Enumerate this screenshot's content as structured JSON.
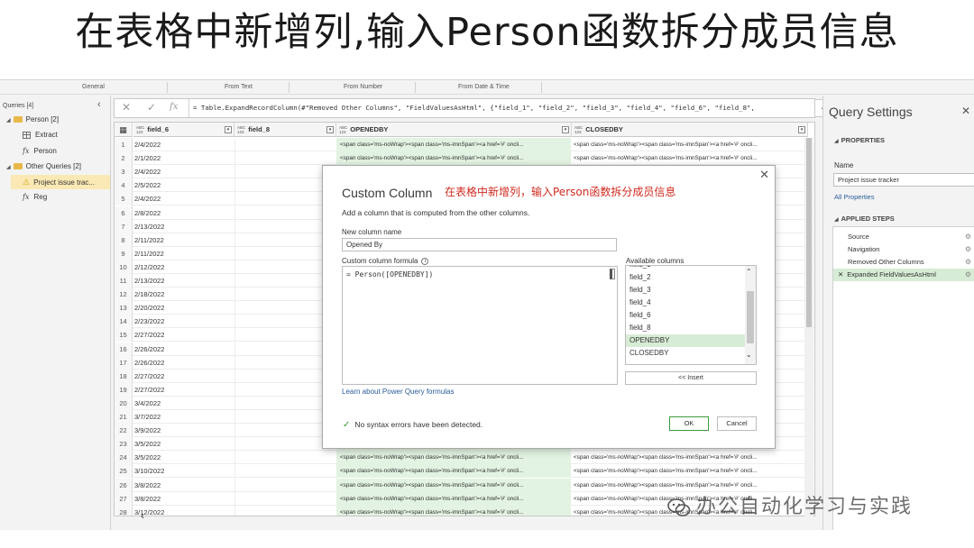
{
  "banner": "在表格中新增列,输入Person函数拆分成员信息",
  "ribbon": {
    "groups": [
      "General",
      "From Text",
      "From Number",
      "From Date & Time"
    ]
  },
  "queries": {
    "header": "Queries [4]",
    "items": [
      {
        "label": "Person [2]",
        "kind": "folder"
      },
      {
        "label": "Extract",
        "kind": "table"
      },
      {
        "label": "Person",
        "kind": "function"
      },
      {
        "label": "Other Queries [2]",
        "kind": "folder"
      },
      {
        "label": "Project issue trac...",
        "kind": "warning"
      },
      {
        "label": "Reg",
        "kind": "function"
      }
    ]
  },
  "formula_bar": {
    "text": "= Table.ExpandRecordColumn(#\"Removed Other Columns\", \"FieldValuesAsHtml\", {\"field_1\", \"field_2\", \"field_3\", \"field_4\", \"field_6\", \"field_8\","
  },
  "grid": {
    "columns": [
      {
        "type": "ABC 123",
        "name": "field_6"
      },
      {
        "type": "ABC 123",
        "name": "field_8"
      },
      {
        "type": "ABC 123",
        "name": "OPENEDBY"
      },
      {
        "type": "ABC 123",
        "name": "CLOSEDBY"
      }
    ],
    "cell_html_open": "<span class='ms-noWrap'><span class='ms-imnSpan'><a href='#' oncli...",
    "cell_html_closed": "<span class='ms-noWrap'><span class='ms-imnSpan'><a href='#' oncli...",
    "cell_html_closed_trunc": "oncli...",
    "rows": [
      {
        "n": "1",
        "date": "2/4/2022"
      },
      {
        "n": "2",
        "date": "2/1/2022"
      },
      {
        "n": "3",
        "date": "2/4/2022"
      },
      {
        "n": "4",
        "date": "2/5/2022"
      },
      {
        "n": "5",
        "date": "2/4/2022"
      },
      {
        "n": "6",
        "date": "2/8/2022"
      },
      {
        "n": "7",
        "date": "2/13/2022"
      },
      {
        "n": "8",
        "date": "2/11/2022"
      },
      {
        "n": "9",
        "date": "2/11/2022"
      },
      {
        "n": "10",
        "date": "2/12/2022"
      },
      {
        "n": "11",
        "date": "2/13/2022"
      },
      {
        "n": "12",
        "date": "2/18/2022"
      },
      {
        "n": "13",
        "date": "2/20/2022"
      },
      {
        "n": "14",
        "date": "2/23/2022"
      },
      {
        "n": "15",
        "date": "2/27/2022"
      },
      {
        "n": "16",
        "date": "2/26/2022"
      },
      {
        "n": "17",
        "date": "2/26/2022"
      },
      {
        "n": "18",
        "date": "2/27/2022"
      },
      {
        "n": "19",
        "date": "2/27/2022"
      },
      {
        "n": "20",
        "date": "3/4/2022"
      },
      {
        "n": "21",
        "date": "3/7/2022"
      },
      {
        "n": "22",
        "date": "3/9/2022"
      },
      {
        "n": "23",
        "date": "3/5/2022"
      },
      {
        "n": "24",
        "date": "3/5/2022"
      },
      {
        "n": "25",
        "date": "3/10/2022"
      },
      {
        "n": "26",
        "date": "3/8/2022"
      },
      {
        "n": "27",
        "date": "3/8/2022"
      },
      {
        "n": "28",
        "date": "3/12/2022"
      }
    ]
  },
  "settings": {
    "title": "Query Settings",
    "properties_header": "PROPERTIES",
    "name_label": "Name",
    "name_value": "Project issue tracker",
    "all_properties": "All Properties",
    "steps_header": "APPLIED STEPS",
    "steps": [
      "Source",
      "Navigation",
      "Removed Other Columns",
      "Expanded FieldValuesAsHtml"
    ]
  },
  "dialog": {
    "title": "Custom Column",
    "annotation": "在表格中新增列，输入Person函数拆分成员信息",
    "description": "Add a column that is computed from the other columns.",
    "new_column_label": "New column name",
    "new_column_value": "Opened By",
    "formula_label": "Custom column formula",
    "formula_value": "= Person([OPENEDBY])",
    "available_label": "Available columns",
    "available_columns": [
      "field_1",
      "field_2",
      "field_3",
      "field_4",
      "field_6",
      "field_8",
      "OPENEDBY",
      "CLOSEDBY"
    ],
    "selected_column": "OPENEDBY",
    "insert_label": "<< Insert",
    "learn_link": "Learn about Power Query formulas",
    "status": "No syntax errors have been detected.",
    "ok_label": "OK",
    "cancel_label": "Cancel"
  },
  "watermark": "办公自动化学习与实践",
  "colors": {
    "accent_green": "#3c9b3c",
    "annotation_red": "#d12b1f",
    "selected_row": "#d7ecd4",
    "folder": "#e8b94a"
  }
}
